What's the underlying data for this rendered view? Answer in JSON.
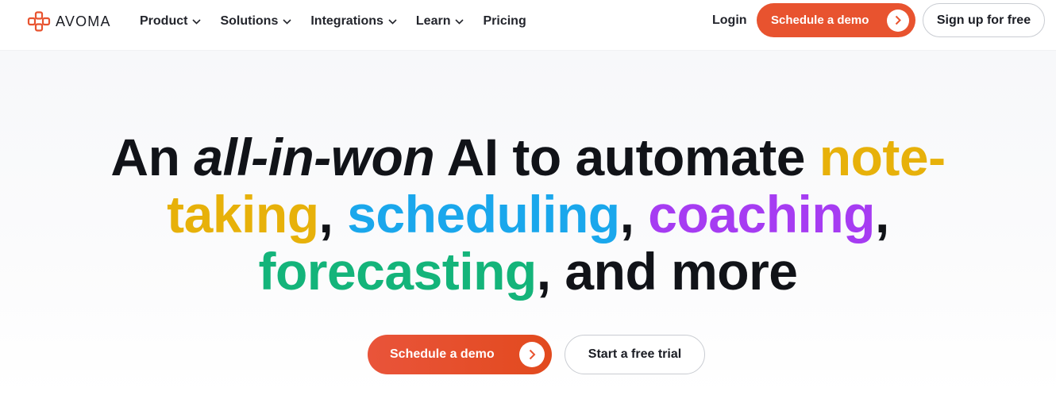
{
  "brand": {
    "name": "AVOMA",
    "accent": "#e8532f"
  },
  "nav": {
    "items": [
      {
        "label": "Product",
        "has_dropdown": true
      },
      {
        "label": "Solutions",
        "has_dropdown": true
      },
      {
        "label": "Integrations",
        "has_dropdown": true
      },
      {
        "label": "Learn",
        "has_dropdown": true
      },
      {
        "label": "Pricing",
        "has_dropdown": false
      }
    ],
    "login": "Login",
    "demo_label": "Schedule a demo",
    "signup_label": "Sign up for free"
  },
  "hero": {
    "h_an": "An",
    "h_italic": "all-in-won",
    "h_rest": "AI to automate",
    "h_note": "note-",
    "h_taking": "taking",
    "h_comma": ",",
    "h_scheduling": "scheduling",
    "h_coaching": "coaching",
    "h_forecasting": "forecasting",
    "h_tail": ", and more",
    "colors": {
      "note_taking": "#e7b10a",
      "scheduling": "#1aa7ec",
      "coaching": "#a63cf2",
      "forecasting": "#14b47a"
    },
    "cta_demo": "Schedule a demo",
    "cta_trial": "Start a free trial"
  },
  "icons": {
    "logo": "avoma-logo-icon",
    "dropdown": "chevron-down-icon",
    "arrow": "chevron-right-icon"
  }
}
